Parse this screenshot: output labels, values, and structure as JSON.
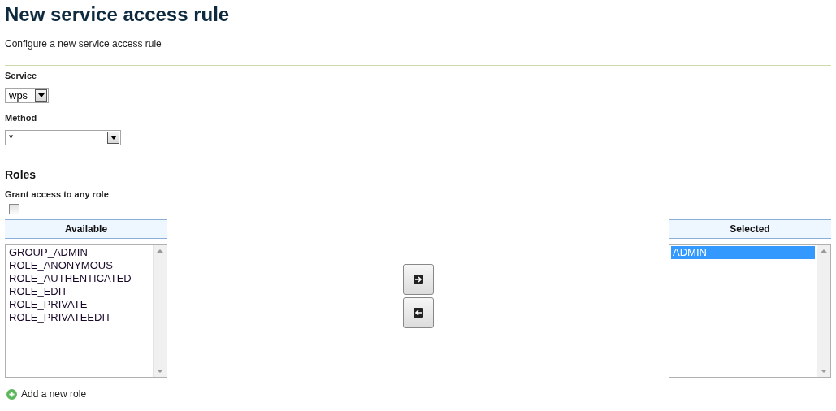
{
  "page": {
    "title": "New service access rule",
    "subtitle": "Configure a new service access rule"
  },
  "service": {
    "label": "Service",
    "value": "wps"
  },
  "method": {
    "label": "Method",
    "value": "*"
  },
  "roles": {
    "heading": "Roles",
    "any_role": {
      "label": "Grant access to any role",
      "checked": false
    },
    "available": {
      "header": "Available",
      "items": [
        {
          "label": "GROUP_ADMIN",
          "selected": false
        },
        {
          "label": "ROLE_ANONYMOUS",
          "selected": false
        },
        {
          "label": "ROLE_AUTHENTICATED",
          "selected": false
        },
        {
          "label": "ROLE_EDIT",
          "selected": false
        },
        {
          "label": "ROLE_PRIVATE",
          "selected": false
        },
        {
          "label": "ROLE_PRIVATEEDIT",
          "selected": false
        }
      ]
    },
    "selected": {
      "header": "Selected",
      "items": [
        {
          "label": "ADMIN",
          "selected": true
        }
      ]
    },
    "add_link": "Add a new role"
  }
}
